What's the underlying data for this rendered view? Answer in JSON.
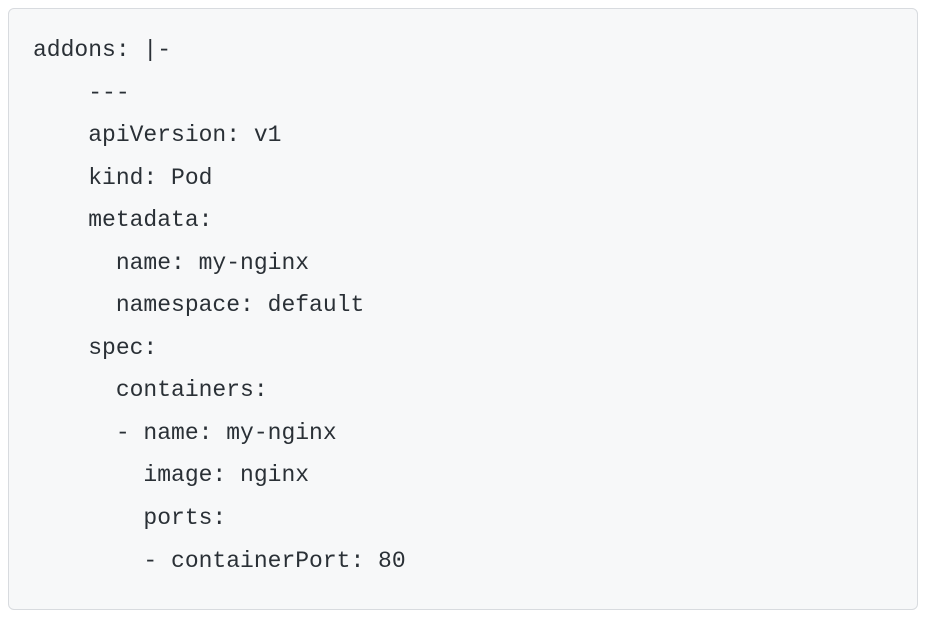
{
  "code": {
    "lines": [
      "addons: |-",
      "    ---",
      "    apiVersion: v1",
      "    kind: Pod",
      "    metadata:",
      "      name: my-nginx",
      "      namespace: default",
      "    spec:",
      "      containers:",
      "      - name: my-nginx",
      "        image: nginx",
      "        ports:",
      "        - containerPort: 80"
    ]
  }
}
